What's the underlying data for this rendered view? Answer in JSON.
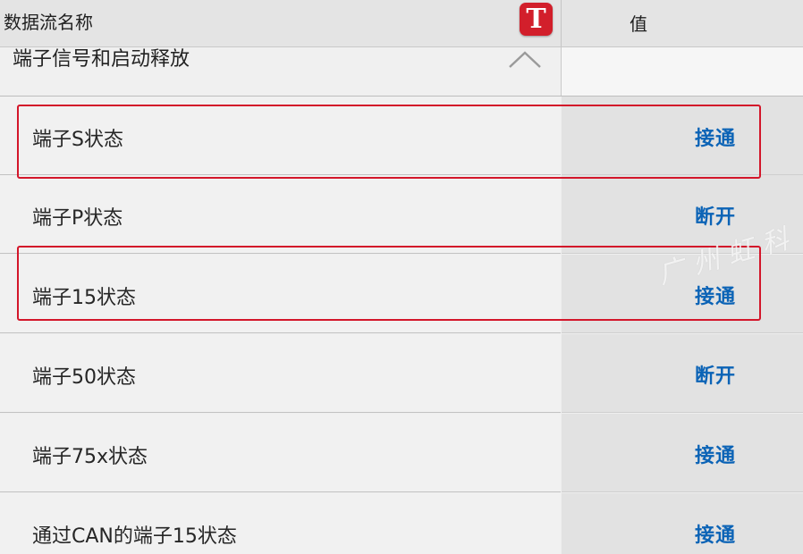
{
  "header": {
    "name_column": "数据流名称",
    "icon_letter": "T",
    "value_column": "值"
  },
  "group": {
    "label": "端子信号和启动释放"
  },
  "rows": [
    {
      "name": "端子S状态",
      "value": "接通"
    },
    {
      "name": "端子P状态",
      "value": "断开"
    },
    {
      "name": "端子15状态",
      "value": "接通"
    },
    {
      "name": "端子50状态",
      "value": "断开"
    },
    {
      "name": "端子75x状态",
      "value": "接通"
    },
    {
      "name": "通过CAN的端子15状态",
      "value": "接通"
    }
  ],
  "watermark": "广州虹科",
  "colors": {
    "value_text": "#0b63b6",
    "highlight": "#d3162a",
    "t_icon": "#d21f2b"
  },
  "icons": {
    "app_icon": "t-letter-icon",
    "collapse": "chevron-up-icon"
  }
}
